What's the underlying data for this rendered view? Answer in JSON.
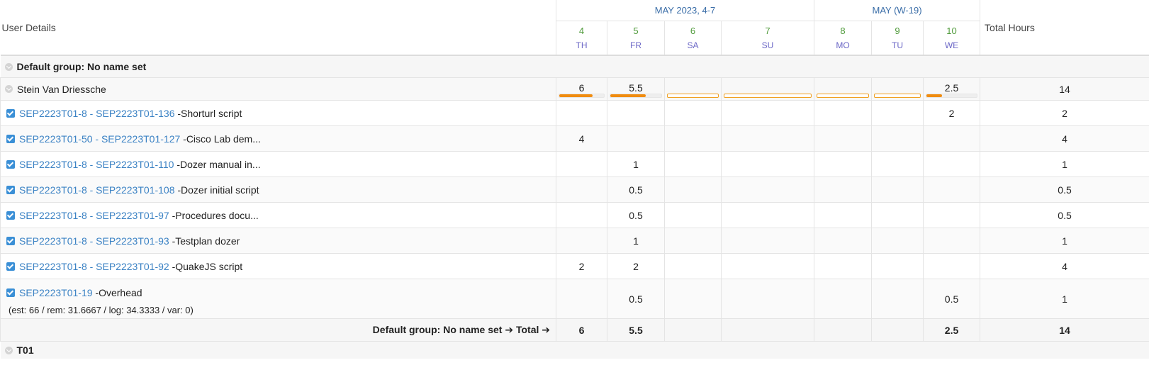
{
  "header": {
    "user_details": "User Details",
    "total_hours": "Total Hours",
    "month_1": "MAY 2023, 4-7",
    "month_2": "MAY (W-19)",
    "days": [
      {
        "num": "4",
        "name": "TH"
      },
      {
        "num": "5",
        "name": "FR"
      },
      {
        "num": "6",
        "name": "SA"
      },
      {
        "num": "7",
        "name": "SU"
      },
      {
        "num": "8",
        "name": "MO"
      },
      {
        "num": "9",
        "name": "TU"
      },
      {
        "num": "10",
        "name": "WE"
      }
    ]
  },
  "group": {
    "label": "Default group: No name set",
    "user": {
      "name": "Stein Van Driessche",
      "day_hours": [
        "6",
        "5.5",
        "",
        "",
        "",
        "",
        "2.5"
      ],
      "day_fill": [
        0.75,
        0.69,
        0,
        0,
        0,
        0,
        0.31
      ],
      "total": "14"
    },
    "tasks": [
      {
        "link": "SEP2223T01-8 - SEP2223T01-136",
        "desc": " -Shorturl script",
        "hours": [
          "",
          "",
          "",
          "",
          "",
          "",
          "2"
        ],
        "total": "2"
      },
      {
        "link": "SEP2223T01-50 - SEP2223T01-127",
        "desc": " -Cisco Lab dem...",
        "hours": [
          "4",
          "",
          "",
          "",
          "",
          "",
          ""
        ],
        "total": "4"
      },
      {
        "link": "SEP2223T01-8 - SEP2223T01-110",
        "desc": " -Dozer manual in...",
        "hours": [
          "",
          "1",
          "",
          "",
          "",
          "",
          ""
        ],
        "total": "1"
      },
      {
        "link": "SEP2223T01-8 - SEP2223T01-108",
        "desc": " -Dozer initial script",
        "hours": [
          "",
          "0.5",
          "",
          "",
          "",
          "",
          ""
        ],
        "total": "0.5"
      },
      {
        "link": "SEP2223T01-8 - SEP2223T01-97",
        "desc": " -Procedures docu...",
        "hours": [
          "",
          "0.5",
          "",
          "",
          "",
          "",
          ""
        ],
        "total": "0.5"
      },
      {
        "link": "SEP2223T01-8 - SEP2223T01-93",
        "desc": " -Testplan dozer",
        "hours": [
          "",
          "1",
          "",
          "",
          "",
          "",
          ""
        ],
        "total": "1"
      },
      {
        "link": "SEP2223T01-8 - SEP2223T01-92",
        "desc": " -QuakeJS script",
        "hours": [
          "2",
          "2",
          "",
          "",
          "",
          "",
          ""
        ],
        "total": "4"
      },
      {
        "link": "SEP2223T01-19",
        "desc": " -Overhead",
        "est": "(est: 66 / rem: 31.6667 / log: 34.3333 / var: 0)",
        "hours": [
          "",
          "0.5",
          "",
          "",
          "",
          "",
          "0.5"
        ],
        "total": "1"
      }
    ],
    "total_label": "Default group: No name set ➔ Total ➔",
    "totals": [
      "6",
      "5.5",
      "",
      "",
      "",
      "",
      "2.5"
    ],
    "grand_total": "14"
  },
  "group2": {
    "label": "T01"
  }
}
